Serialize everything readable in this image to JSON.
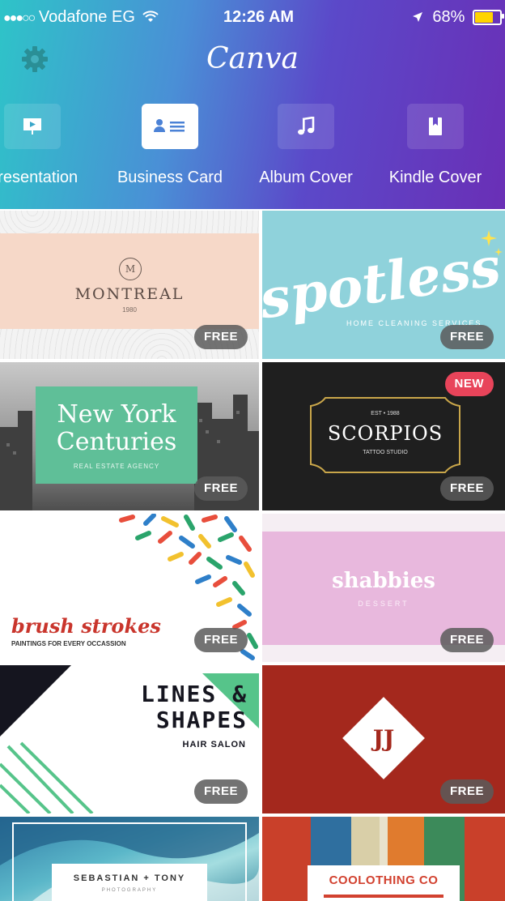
{
  "status_bar": {
    "signal_dots": "●●●○○",
    "carrier": "Vodafone EG",
    "time": "12:26 AM",
    "battery": "68%"
  },
  "header": {
    "brand": "Canva"
  },
  "categories": [
    {
      "label": "Presentation",
      "icon": "presentation-icon"
    },
    {
      "label": "Business Card",
      "icon": "business-card-icon",
      "active": true
    },
    {
      "label": "Album Cover",
      "icon": "music-note-icon"
    },
    {
      "label": "Kindle Cover",
      "icon": "book-icon"
    }
  ],
  "badges": {
    "free": "FREE",
    "new": "NEW"
  },
  "templates": {
    "montreal": {
      "monogram": "M",
      "title": "MONTREAL",
      "year": "1980",
      "badge": "FREE"
    },
    "spotless": {
      "title": "spotless",
      "subtitle": "HOME CLEANING SERVICES",
      "badge": "FREE"
    },
    "new_york": {
      "line1": "New York",
      "line2": "Centuries",
      "subtitle": "REAL ESTATE AGENCY",
      "badge": "FREE"
    },
    "scorpios": {
      "est": "EST • 1988",
      "title": "SCORPIOS",
      "subtitle": "TATTOO STUDIO",
      "badge": "FREE",
      "badge_top": "NEW"
    },
    "brush": {
      "title": "brush strokes",
      "subtitle": "PAINTINGS FOR EVERY OCCASSION",
      "badge": "FREE"
    },
    "shabbies": {
      "title": "shabbies",
      "subtitle": "DESSERT",
      "badge": "FREE"
    },
    "lines": {
      "line1": "LINES &",
      "line2": "SHAPES",
      "subtitle": "HAIR SALON",
      "badge": "FREE"
    },
    "jj": {
      "monogram": "JJ",
      "badge": "FREE"
    },
    "sebastian": {
      "title": "SEBASTIAN + TONY",
      "subtitle": "PHOTOGRAPHY"
    },
    "coolothing": {
      "title": "COOLOTHING CO"
    }
  }
}
